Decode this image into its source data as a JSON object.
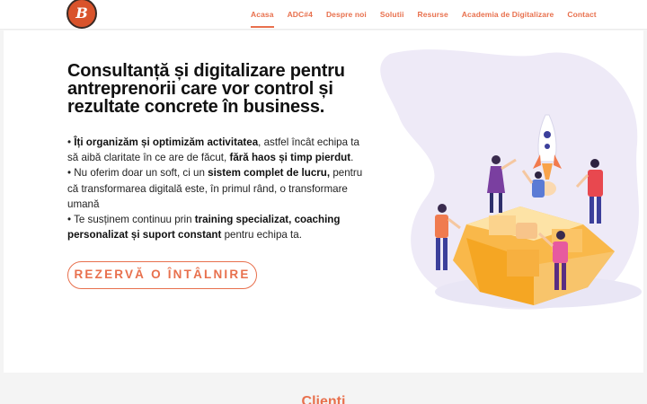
{
  "header": {
    "logo_letter": "B",
    "nav": [
      {
        "label": "Acasa",
        "active": true
      },
      {
        "label": "ADC#4",
        "active": false
      },
      {
        "label": "Despre noi",
        "active": false
      },
      {
        "label": "Solutii",
        "active": false
      },
      {
        "label": "Resurse",
        "active": false
      },
      {
        "label": "Academia de Digitalizare",
        "active": false
      },
      {
        "label": "Contact",
        "active": false
      }
    ]
  },
  "hero": {
    "headline": "Consultanță și digitalizare pentru antreprenorii care vor control și rezultate concrete în business.",
    "bullets": [
      {
        "prefix": "• ",
        "bold1": "Îți organizăm și optimizăm activitatea",
        "text1": ", astfel încât echipa ta să aibă claritate în ce are de făcut, ",
        "bold2": "fără haos și timp pierdut",
        "text2": "."
      },
      {
        "prefix": "• Nu oferim doar un soft, ci un ",
        "bold1": "sistem complet de lucru,",
        "text1": " pentru că transformarea digitală este, în primul rând, o transformare umană",
        "bold2": "",
        "text2": ""
      },
      {
        "prefix": "• Te susținem continuu prin ",
        "bold1": "training specializat, coaching personalizat și suport constant",
        "text1": " pentru echipa ta.",
        "bold2": "",
        "text2": ""
      }
    ],
    "cta_label": "REZERVĂ O ÎNTÂLNIRE"
  },
  "clients": {
    "title": "Clienti"
  },
  "colors": {
    "accent": "#e8704d",
    "logo_bg": "#d9532b"
  }
}
